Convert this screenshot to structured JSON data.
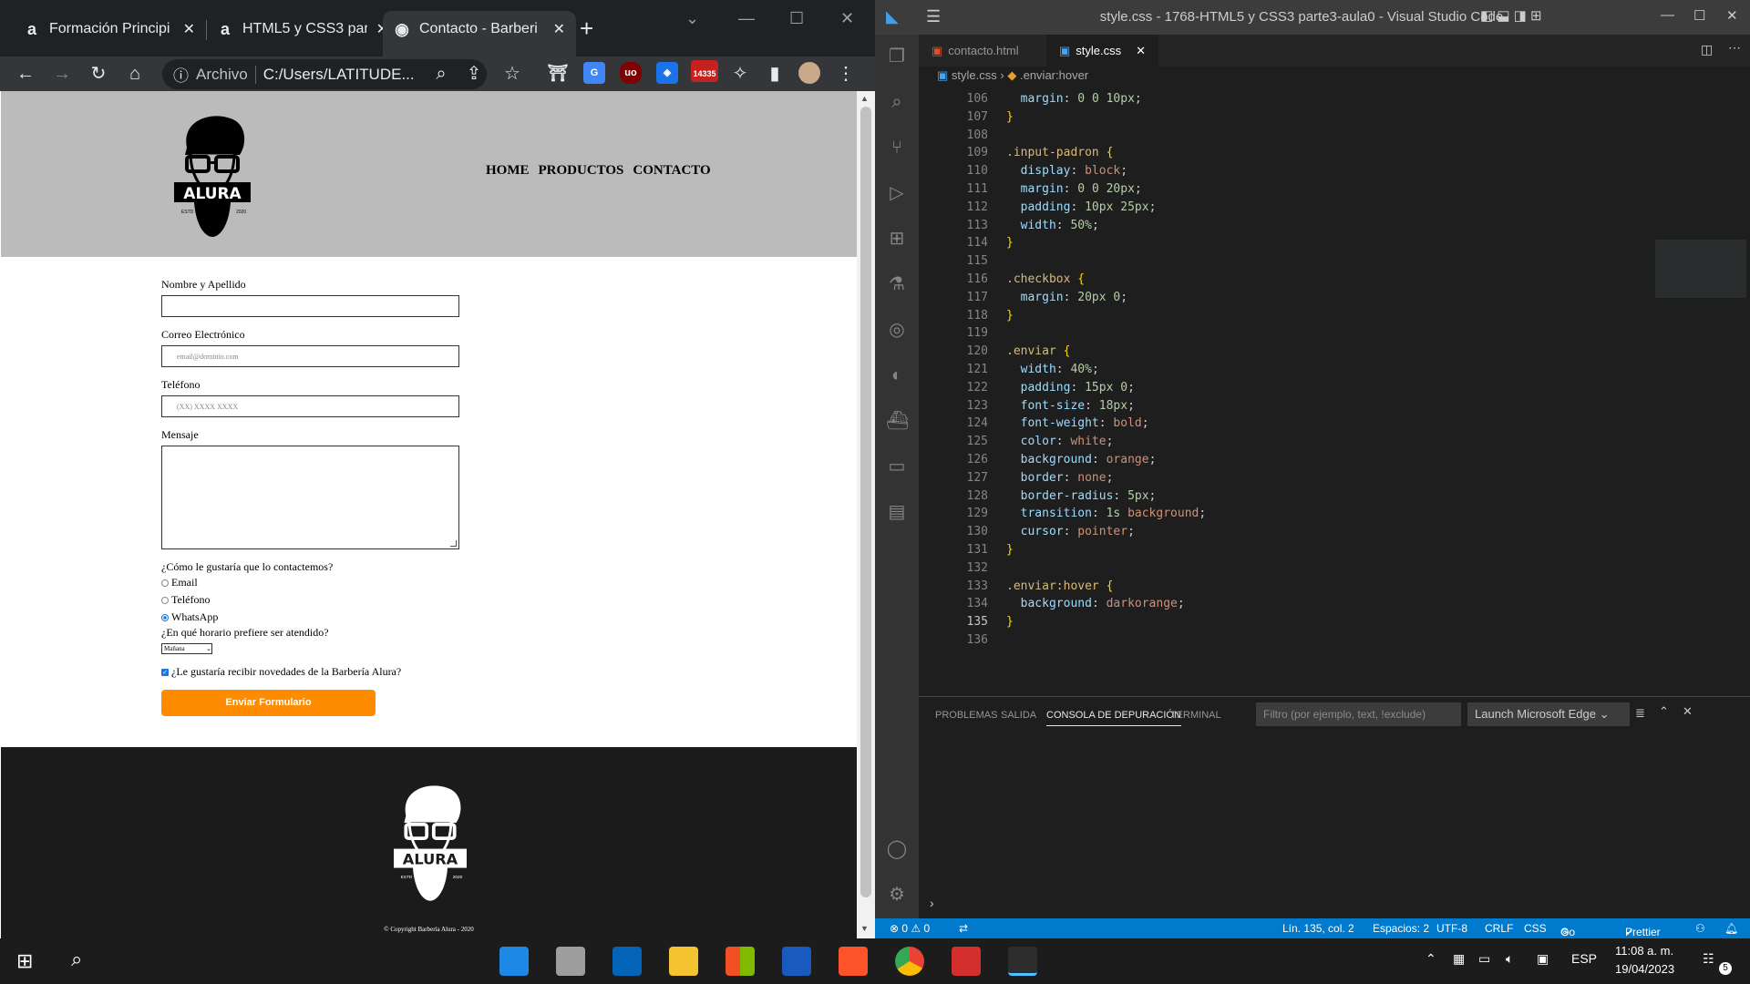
{
  "browser": {
    "tabs": [
      {
        "icon": "a",
        "title": "Formación Principi"
      },
      {
        "icon": "a",
        "title": "HTML5 y CSS3 par"
      },
      {
        "icon": "◉",
        "title": "Contacto - Barberi"
      }
    ],
    "address_label": "Archivo",
    "address_value": "C:/Users/LATITUDE...",
    "mail_badge": "14335"
  },
  "site": {
    "logo_text": "ALURA",
    "logo_estd": "ESTD",
    "logo_year": "2020",
    "nav": [
      "HOME",
      "PRODUCTOS",
      "CONTACTO"
    ],
    "form": {
      "name_label": "Nombre y Apellido",
      "email_label": "Correo Electrónico",
      "email_placeholder": "email@dominio.com",
      "phone_label": "Teléfono",
      "phone_placeholder": "(XX) XXXX XXXX",
      "message_label": "Mensaje",
      "contact_question": "¿Cómo le gustaría que lo contactemos?",
      "contact_options": [
        "Email",
        "Teléfono",
        "WhatsApp"
      ],
      "contact_selected": "WhatsApp",
      "schedule_question": "¿En qué horario prefiere ser atendido?",
      "schedule_value": "Mañana",
      "newsletter_label": "¿Le gustaría recibir novedades de la Barbería Alura?",
      "newsletter_checked": true,
      "submit_label": "Enviar Formulario"
    },
    "copyright": "© Copyright Barbería Alura - 2020"
  },
  "vscode": {
    "title": "style.css - 1768-HTML5 y CSS3 parte3-aula0 - Visual Studio Code",
    "tabs": [
      "contacto.html",
      "style.css"
    ],
    "breadcrumb_file": "style.css",
    "breadcrumb_symbol": ".enviar:hover",
    "code_lines": [
      {
        "n": "106",
        "text": "  margin: 0 0 10px;"
      },
      {
        "n": "107",
        "text": "}"
      },
      {
        "n": "108",
        "text": ""
      },
      {
        "n": "109",
        "text": ".input-padron {"
      },
      {
        "n": "110",
        "text": "  display: block;"
      },
      {
        "n": "111",
        "text": "  margin: 0 0 20px;"
      },
      {
        "n": "112",
        "text": "  padding: 10px 25px;"
      },
      {
        "n": "113",
        "text": "  width: 50%;"
      },
      {
        "n": "114",
        "text": "}"
      },
      {
        "n": "115",
        "text": ""
      },
      {
        "n": "116",
        "text": ".checkbox {"
      },
      {
        "n": "117",
        "text": "  margin: 20px 0;"
      },
      {
        "n": "118",
        "text": "}"
      },
      {
        "n": "119",
        "text": ""
      },
      {
        "n": "120",
        "text": ".enviar {"
      },
      {
        "n": "121",
        "text": "  width: 40%;"
      },
      {
        "n": "122",
        "text": "  padding: 15px 0;"
      },
      {
        "n": "123",
        "text": "  font-size: 18px;"
      },
      {
        "n": "124",
        "text": "  font-weight: bold;"
      },
      {
        "n": "125",
        "text": "  color: white;"
      },
      {
        "n": "126",
        "text": "  background: orange;"
      },
      {
        "n": "127",
        "text": "  border: none;"
      },
      {
        "n": "128",
        "text": "  border-radius: 5px;"
      },
      {
        "n": "129",
        "text": "  transition: 1s background;"
      },
      {
        "n": "130",
        "text": "  cursor: pointer;"
      },
      {
        "n": "131",
        "text": "}"
      },
      {
        "n": "132",
        "text": ""
      },
      {
        "n": "133",
        "text": ".enviar:hover {"
      },
      {
        "n": "134",
        "text": "  background: darkorange;"
      },
      {
        "n": "135",
        "text": "}"
      },
      {
        "n": "136",
        "text": ""
      }
    ],
    "current_line": "135",
    "panel_tabs": [
      "PROBLEMAS",
      "SALIDA",
      "CONSOLA DE DEPURACIÓN",
      "TERMINAL"
    ],
    "panel_active": "CONSOLA DE DEPURACIÓN",
    "filter_placeholder": "Filtro (por ejemplo, text, !exclude)",
    "launch_config": "Launch Microsoft Edge",
    "status": {
      "problems": "⊗ 0 ⚠ 0",
      "position": "Lín. 135, col. 2",
      "spaces": "Espacios: 2",
      "encoding": "UTF-8",
      "eol": "CRLF",
      "language": "CSS",
      "golive": "Go Live",
      "prettier": "Prettier"
    }
  },
  "taskbar": {
    "lang": "ESP",
    "time": "11:08 a. m.",
    "date": "19/04/2023",
    "notif_count": "5"
  },
  "colors": {
    "accent_orange": "#ff8c00",
    "vscode_blue": "#007acc"
  }
}
